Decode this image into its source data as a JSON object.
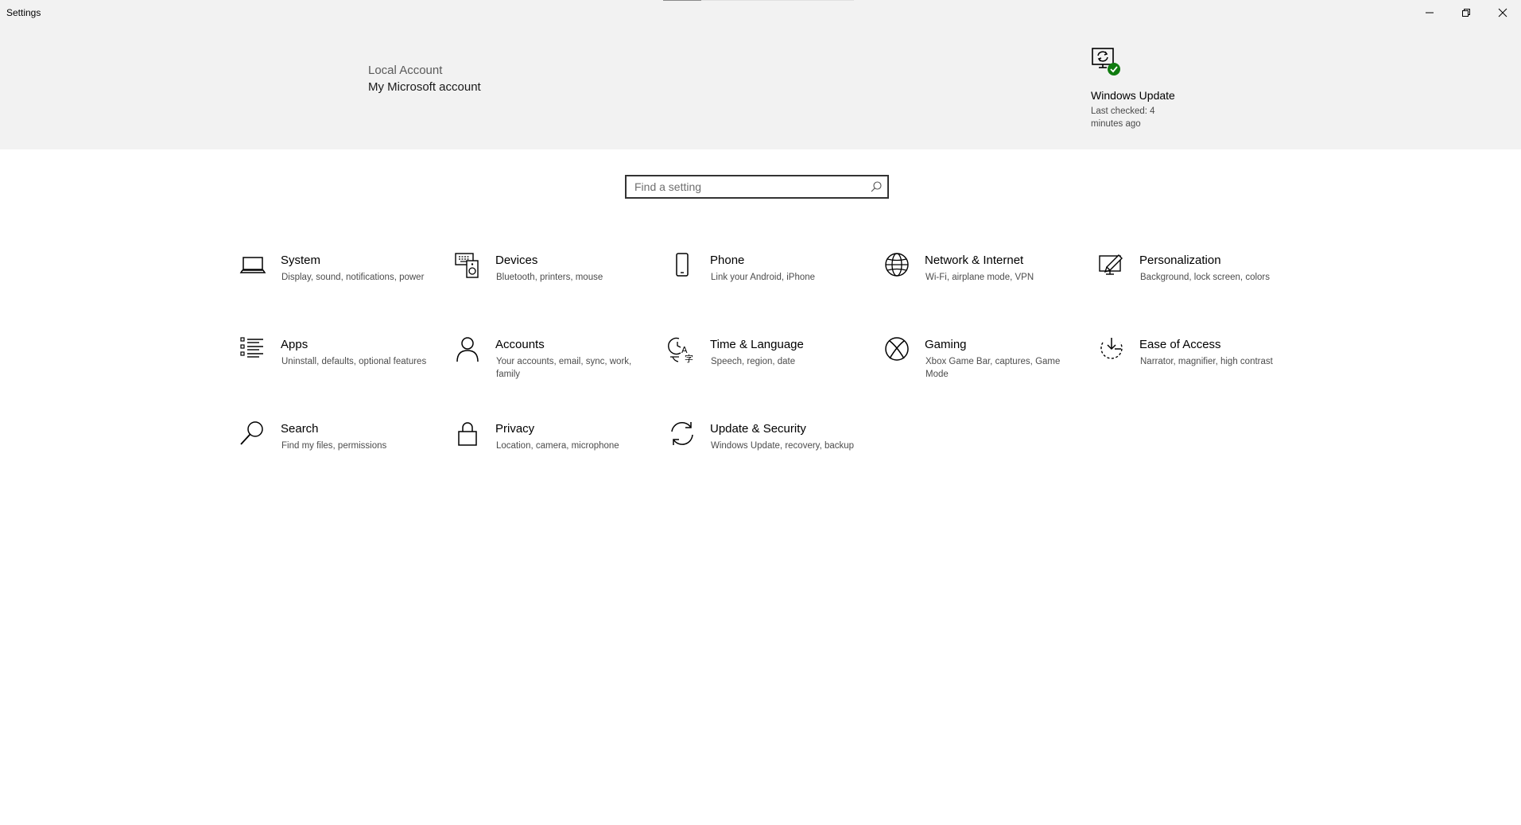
{
  "window": {
    "title": "Settings",
    "update_progress": 0.2
  },
  "account": {
    "type_label": "Local Account",
    "link_label": "My Microsoft account"
  },
  "windows_update": {
    "title": "Windows Update",
    "status": "Last checked: 4 minutes ago",
    "icon": "windows-update-icon",
    "badge_color": "#107c10"
  },
  "search": {
    "placeholder": "Find a setting",
    "value": ""
  },
  "categories": [
    {
      "name": "System",
      "desc": "Display, sound, notifications, power",
      "icon": "laptop-icon"
    },
    {
      "name": "Devices",
      "desc": "Bluetooth, printers, mouse",
      "icon": "devices-icon"
    },
    {
      "name": "Phone",
      "desc": "Link your Android, iPhone",
      "icon": "phone-icon"
    },
    {
      "name": "Network & Internet",
      "desc": "Wi-Fi, airplane mode, VPN",
      "icon": "globe-icon"
    },
    {
      "name": "Personalization",
      "desc": "Background, lock screen, colors",
      "icon": "personalization-icon"
    },
    {
      "name": "Apps",
      "desc": "Uninstall, defaults, optional features",
      "icon": "apps-list-icon"
    },
    {
      "name": "Accounts",
      "desc": "Your accounts, email, sync, work, family",
      "icon": "person-icon"
    },
    {
      "name": "Time & Language",
      "desc": "Speech, region, date",
      "icon": "time-language-icon"
    },
    {
      "name": "Gaming",
      "desc": "Xbox Game Bar, captures, Game Mode",
      "icon": "xbox-icon"
    },
    {
      "name": "Ease of Access",
      "desc": "Narrator, magnifier, high contrast",
      "icon": "ease-of-access-icon"
    },
    {
      "name": "Search",
      "desc": "Find my files, permissions",
      "icon": "search-icon"
    },
    {
      "name": "Privacy",
      "desc": "Location, camera, microphone",
      "icon": "lock-icon"
    },
    {
      "name": "Update & Security",
      "desc": "Windows Update, recovery, backup",
      "icon": "sync-icon"
    }
  ]
}
